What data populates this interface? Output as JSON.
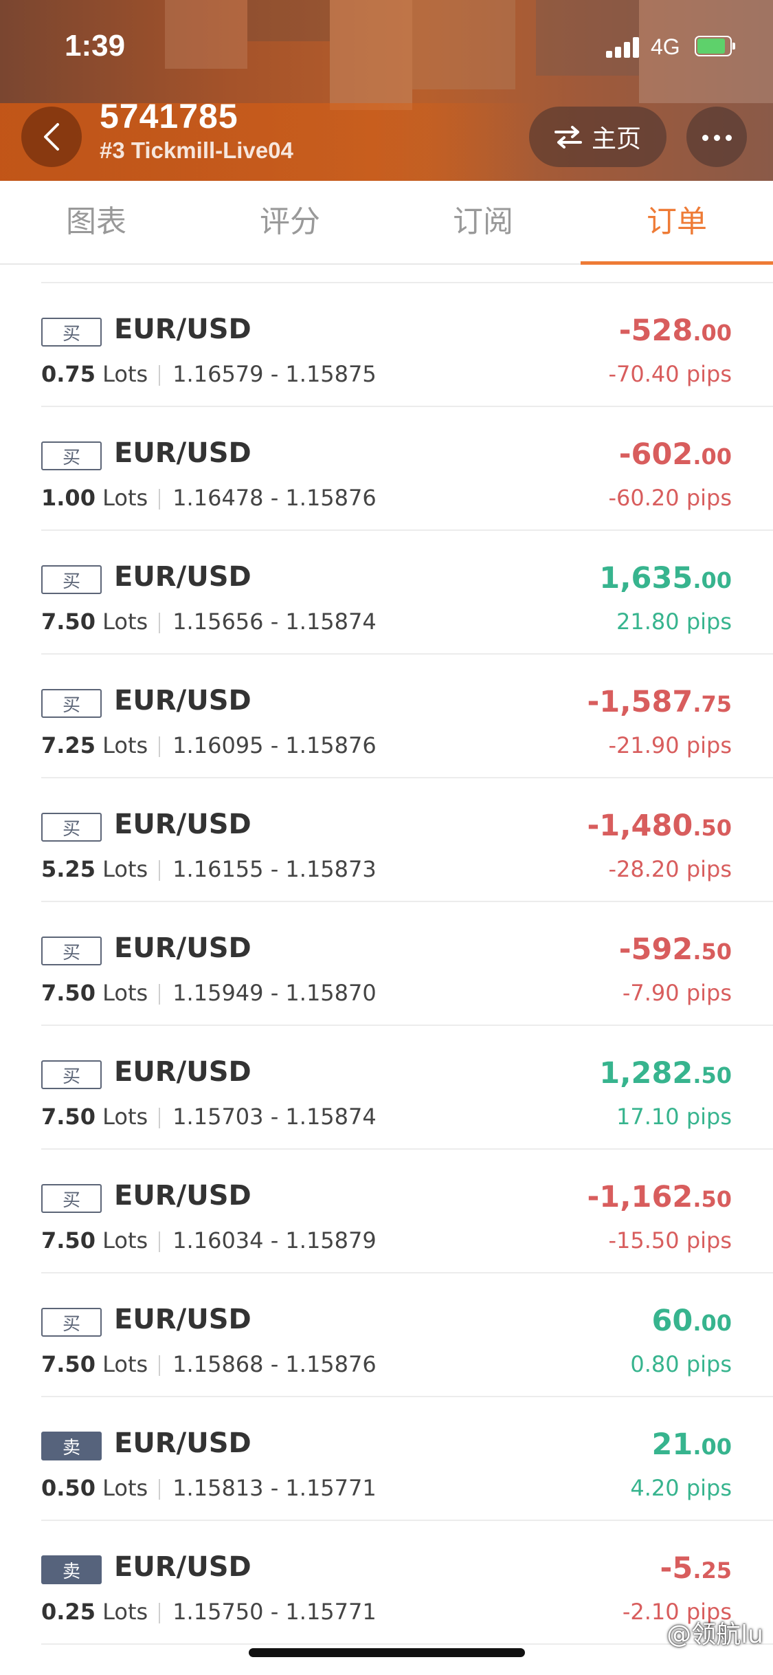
{
  "status_bar": {
    "time": "1:39",
    "network": "4G"
  },
  "header": {
    "account_number": "5741785",
    "server": "#3 Tickmill-Live04",
    "home_label": "主页",
    "icons": {
      "back": "back-chevron-icon",
      "home": "swap-arrows-icon",
      "more": "more-dots-icon"
    }
  },
  "tabs": [
    {
      "label": "图表",
      "active": false
    },
    {
      "label": "评分",
      "active": false
    },
    {
      "label": "订阅",
      "active": false
    },
    {
      "label": "订单",
      "active": true
    }
  ],
  "orders": [
    {
      "side": "买",
      "type": "buy",
      "symbol": "EUR/USD",
      "lots": "0.75",
      "lots_unit": "Lots",
      "range": "1.16579 - 1.15875",
      "profit_int": "-528",
      "profit_dec": ".00",
      "pips": "-70.40 pips",
      "trend": "neg"
    },
    {
      "side": "买",
      "type": "buy",
      "symbol": "EUR/USD",
      "lots": "1.00",
      "lots_unit": "Lots",
      "range": "1.16478 - 1.15876",
      "profit_int": "-602",
      "profit_dec": ".00",
      "pips": "-60.20 pips",
      "trend": "neg"
    },
    {
      "side": "买",
      "type": "buy",
      "symbol": "EUR/USD",
      "lots": "7.50",
      "lots_unit": "Lots",
      "range": "1.15656 - 1.15874",
      "profit_int": "1,635",
      "profit_dec": ".00",
      "pips": "21.80 pips",
      "trend": "pos"
    },
    {
      "side": "买",
      "type": "buy",
      "symbol": "EUR/USD",
      "lots": "7.25",
      "lots_unit": "Lots",
      "range": "1.16095 - 1.15876",
      "profit_int": "-1,587",
      "profit_dec": ".75",
      "pips": "-21.90 pips",
      "trend": "neg"
    },
    {
      "side": "买",
      "type": "buy",
      "symbol": "EUR/USD",
      "lots": "5.25",
      "lots_unit": "Lots",
      "range": "1.16155 - 1.15873",
      "profit_int": "-1,480",
      "profit_dec": ".50",
      "pips": "-28.20 pips",
      "trend": "neg"
    },
    {
      "side": "买",
      "type": "buy",
      "symbol": "EUR/USD",
      "lots": "7.50",
      "lots_unit": "Lots",
      "range": "1.15949 - 1.15870",
      "profit_int": "-592",
      "profit_dec": ".50",
      "pips": "-7.90 pips",
      "trend": "neg"
    },
    {
      "side": "买",
      "type": "buy",
      "symbol": "EUR/USD",
      "lots": "7.50",
      "lots_unit": "Lots",
      "range": "1.15703 - 1.15874",
      "profit_int": "1,282",
      "profit_dec": ".50",
      "pips": "17.10 pips",
      "trend": "pos"
    },
    {
      "side": "买",
      "type": "buy",
      "symbol": "EUR/USD",
      "lots": "7.50",
      "lots_unit": "Lots",
      "range": "1.16034 - 1.15879",
      "profit_int": "-1,162",
      "profit_dec": ".50",
      "pips": "-15.50 pips",
      "trend": "neg"
    },
    {
      "side": "买",
      "type": "buy",
      "symbol": "EUR/USD",
      "lots": "7.50",
      "lots_unit": "Lots",
      "range": "1.15868 - 1.15876",
      "profit_int": "60",
      "profit_dec": ".00",
      "pips": "0.80 pips",
      "trend": "pos"
    },
    {
      "side": "卖",
      "type": "sell",
      "symbol": "EUR/USD",
      "lots": "0.50",
      "lots_unit": "Lots",
      "range": "1.15813 - 1.15771",
      "profit_int": "21",
      "profit_dec": ".00",
      "pips": "4.20 pips",
      "trend": "pos"
    },
    {
      "side": "卖",
      "type": "sell",
      "symbol": "EUR/USD",
      "lots": "0.25",
      "lots_unit": "Lots",
      "range": "1.15750 - 1.15771",
      "profit_int": "-5",
      "profit_dec": ".25",
      "pips": "-2.10 pips",
      "trend": "neg"
    }
  ],
  "watermark": "@领航lu",
  "colors": {
    "accent": "#ee7b36",
    "loss": "#d85d5d",
    "gain": "#37b48e",
    "sell_badge": "#56637c"
  }
}
